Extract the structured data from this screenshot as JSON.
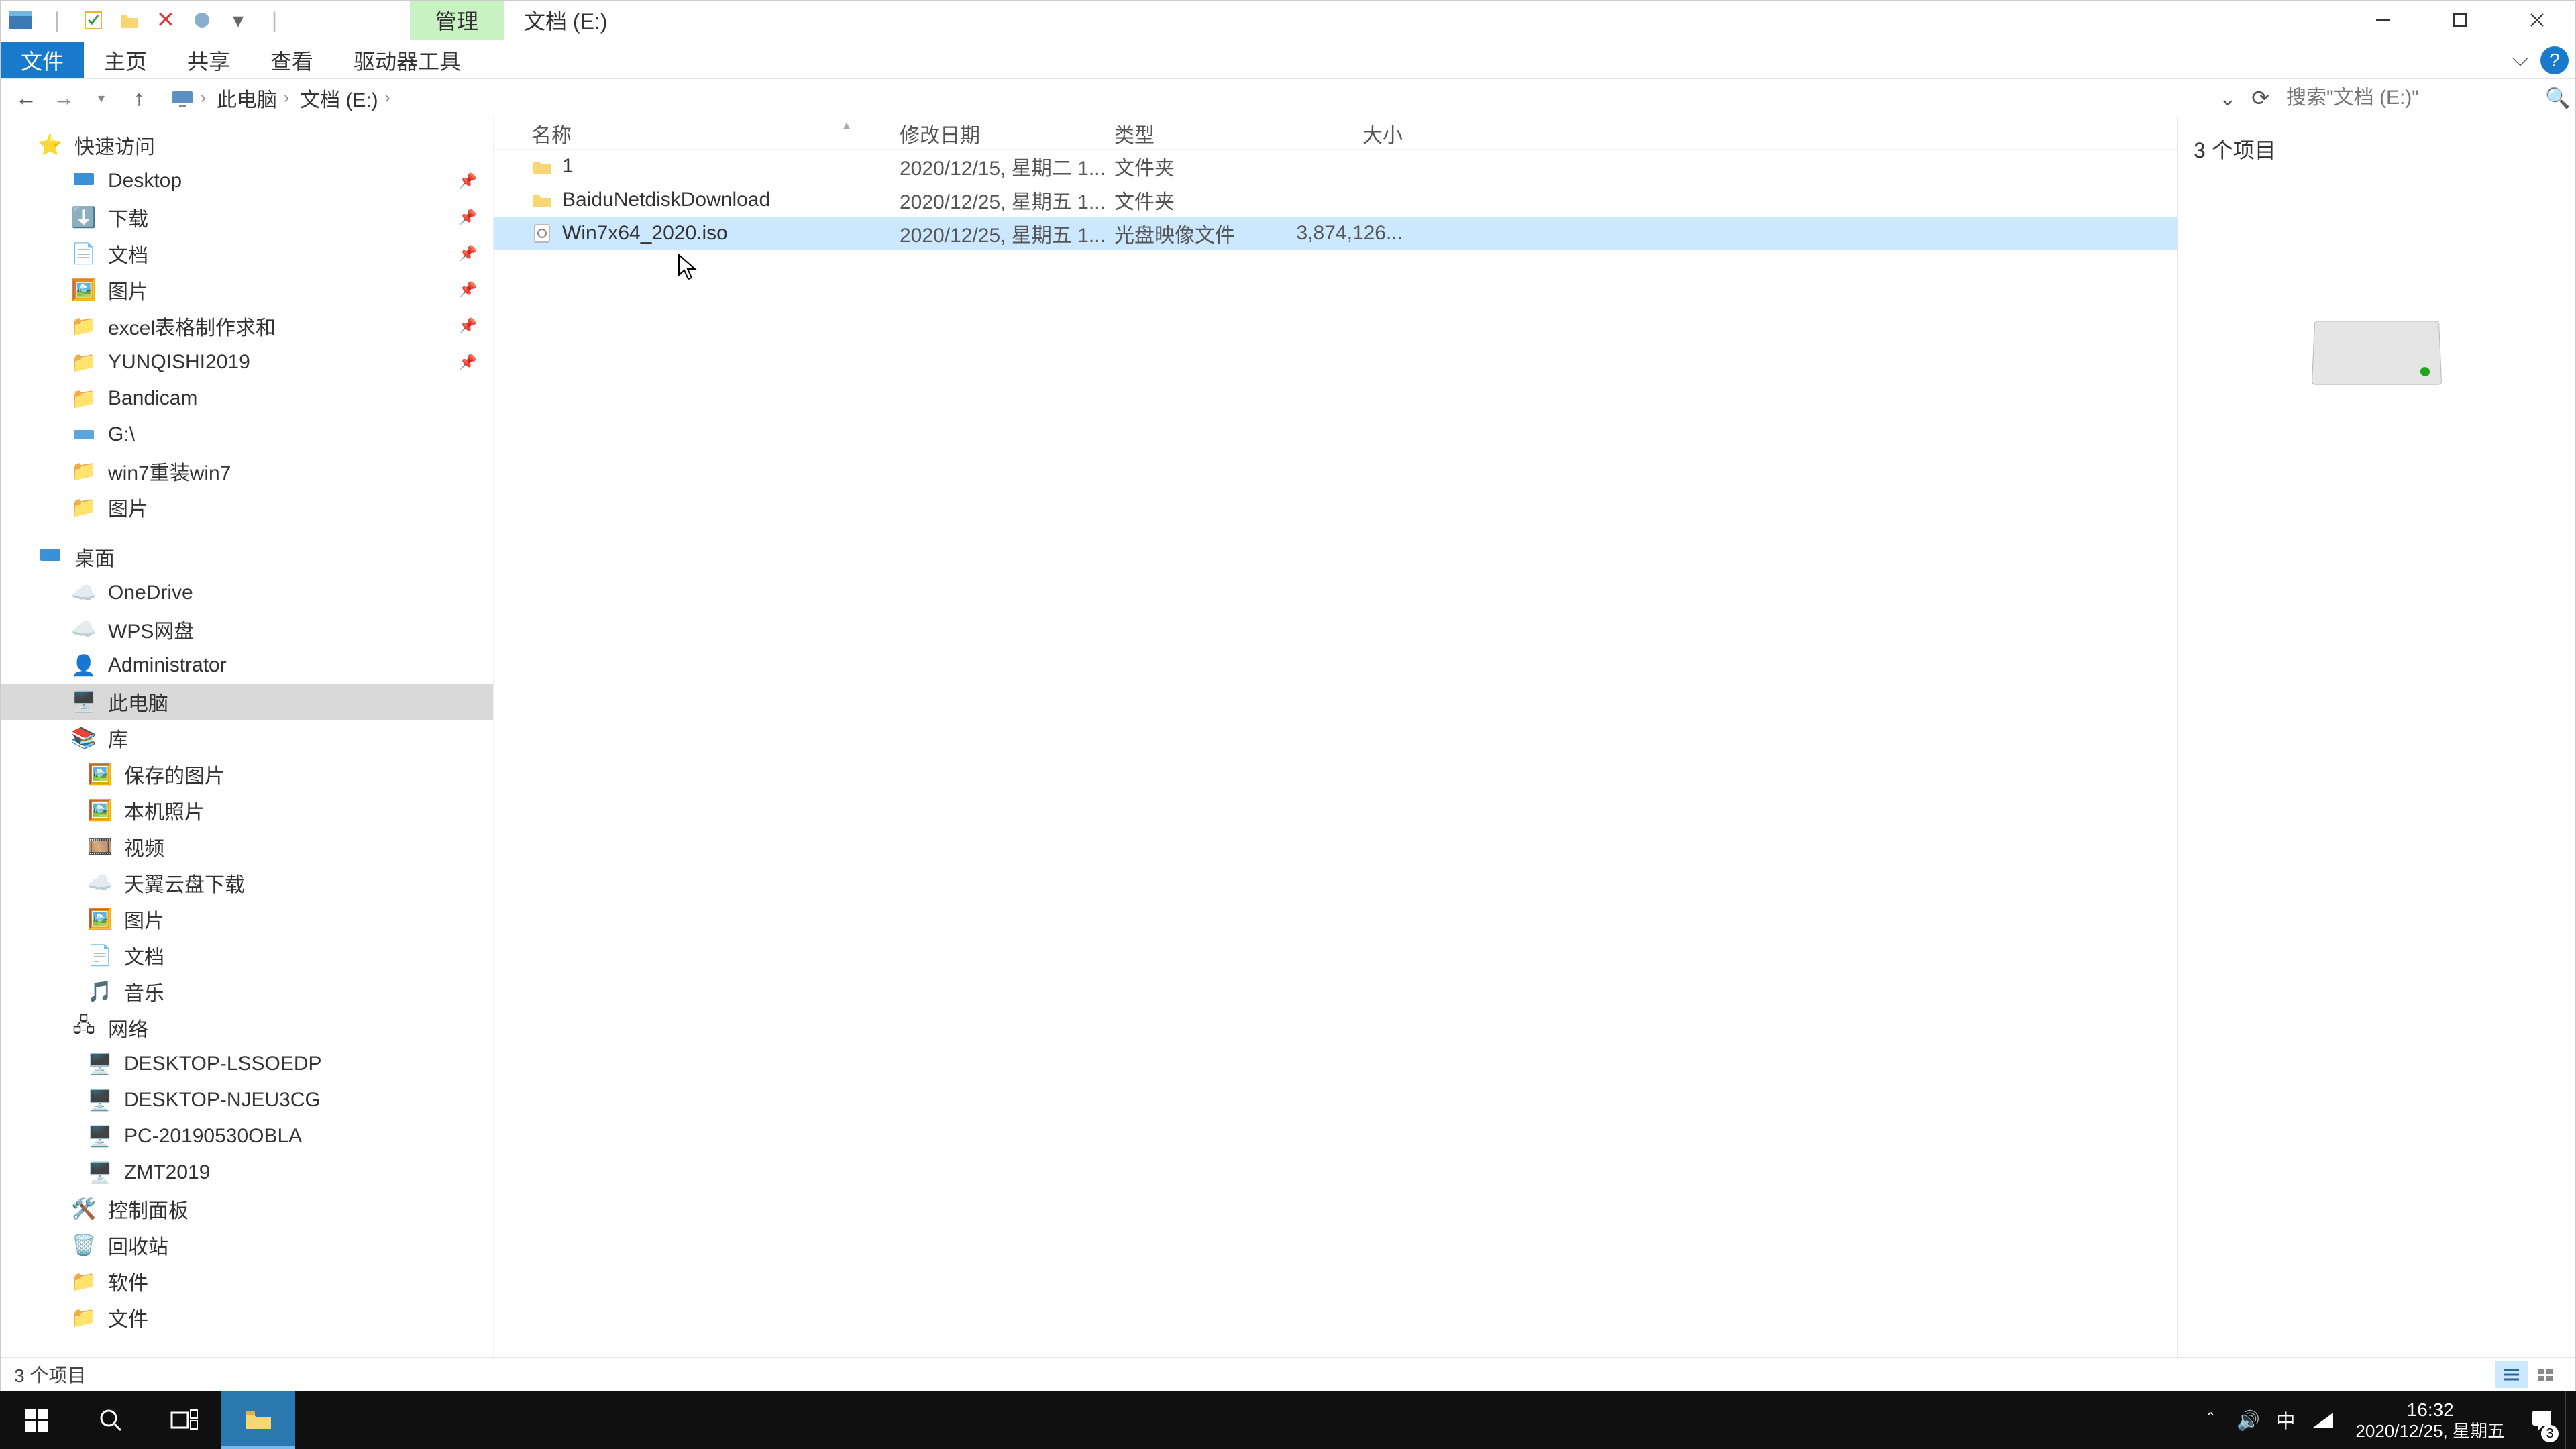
{
  "title_context_tab": "管理",
  "title_location": "文档 (E:)",
  "ribbon": {
    "file": "文件",
    "home": "主页",
    "share": "共享",
    "view": "查看",
    "drive": "驱动器工具"
  },
  "breadcrumbs": {
    "root": "此电脑",
    "loc": "文档 (E:)"
  },
  "search_placeholder": "搜索\"文档 (E:)\"",
  "columns": {
    "name": "名称",
    "date": "修改日期",
    "type": "类型",
    "size": "大小"
  },
  "sidebar": {
    "quick": "快速访问",
    "desktop": "Desktop",
    "downloads": "下载",
    "documents": "文档",
    "pictures": "图片",
    "excel": "excel表格制作求和",
    "yunqishi": "YUNQISHI2019",
    "bandicam": "Bandicam",
    "gdrive": "G:\\",
    "win7": "win7重装win7",
    "pictures2": "图片",
    "desk_sec": "桌面",
    "onedrive": "OneDrive",
    "wps": "WPS网盘",
    "admin": "Administrator",
    "thispc": "此电脑",
    "lib": "库",
    "savedpics": "保存的图片",
    "localpics": "本机照片",
    "video": "视频",
    "tianyidl": "天翼云盘下载",
    "pictures3": "图片",
    "documents2": "文档",
    "music": "音乐",
    "network": "网络",
    "net1": "DESKTOP-LSSOEDP",
    "net2": "DESKTOP-NJEU3CG",
    "net3": "PC-20190530OBLA",
    "net4": "ZMT2019",
    "ctrl": "控制面板",
    "recycle": "回收站",
    "soft": "软件",
    "files": "文件"
  },
  "rows": [
    {
      "name": "1",
      "date": "2020/12/15, 星期二 1...",
      "type": "文件夹",
      "size": "",
      "kind": "folder",
      "sel": false
    },
    {
      "name": "BaiduNetdiskDownload",
      "date": "2020/12/25, 星期五 1...",
      "type": "文件夹",
      "size": "",
      "kind": "folder",
      "sel": false
    },
    {
      "name": "Win7x64_2020.iso",
      "date": "2020/12/25, 星期五 1...",
      "type": "光盘映像文件",
      "size": "3,874,126...",
      "kind": "iso",
      "sel": true
    }
  ],
  "preview": {
    "count": "3 个项目"
  },
  "status": {
    "text": "3 个项目"
  },
  "taskbar": {
    "time": "16:32",
    "date": "2020/12/25, 星期五",
    "ime": "中",
    "notif": "3"
  }
}
